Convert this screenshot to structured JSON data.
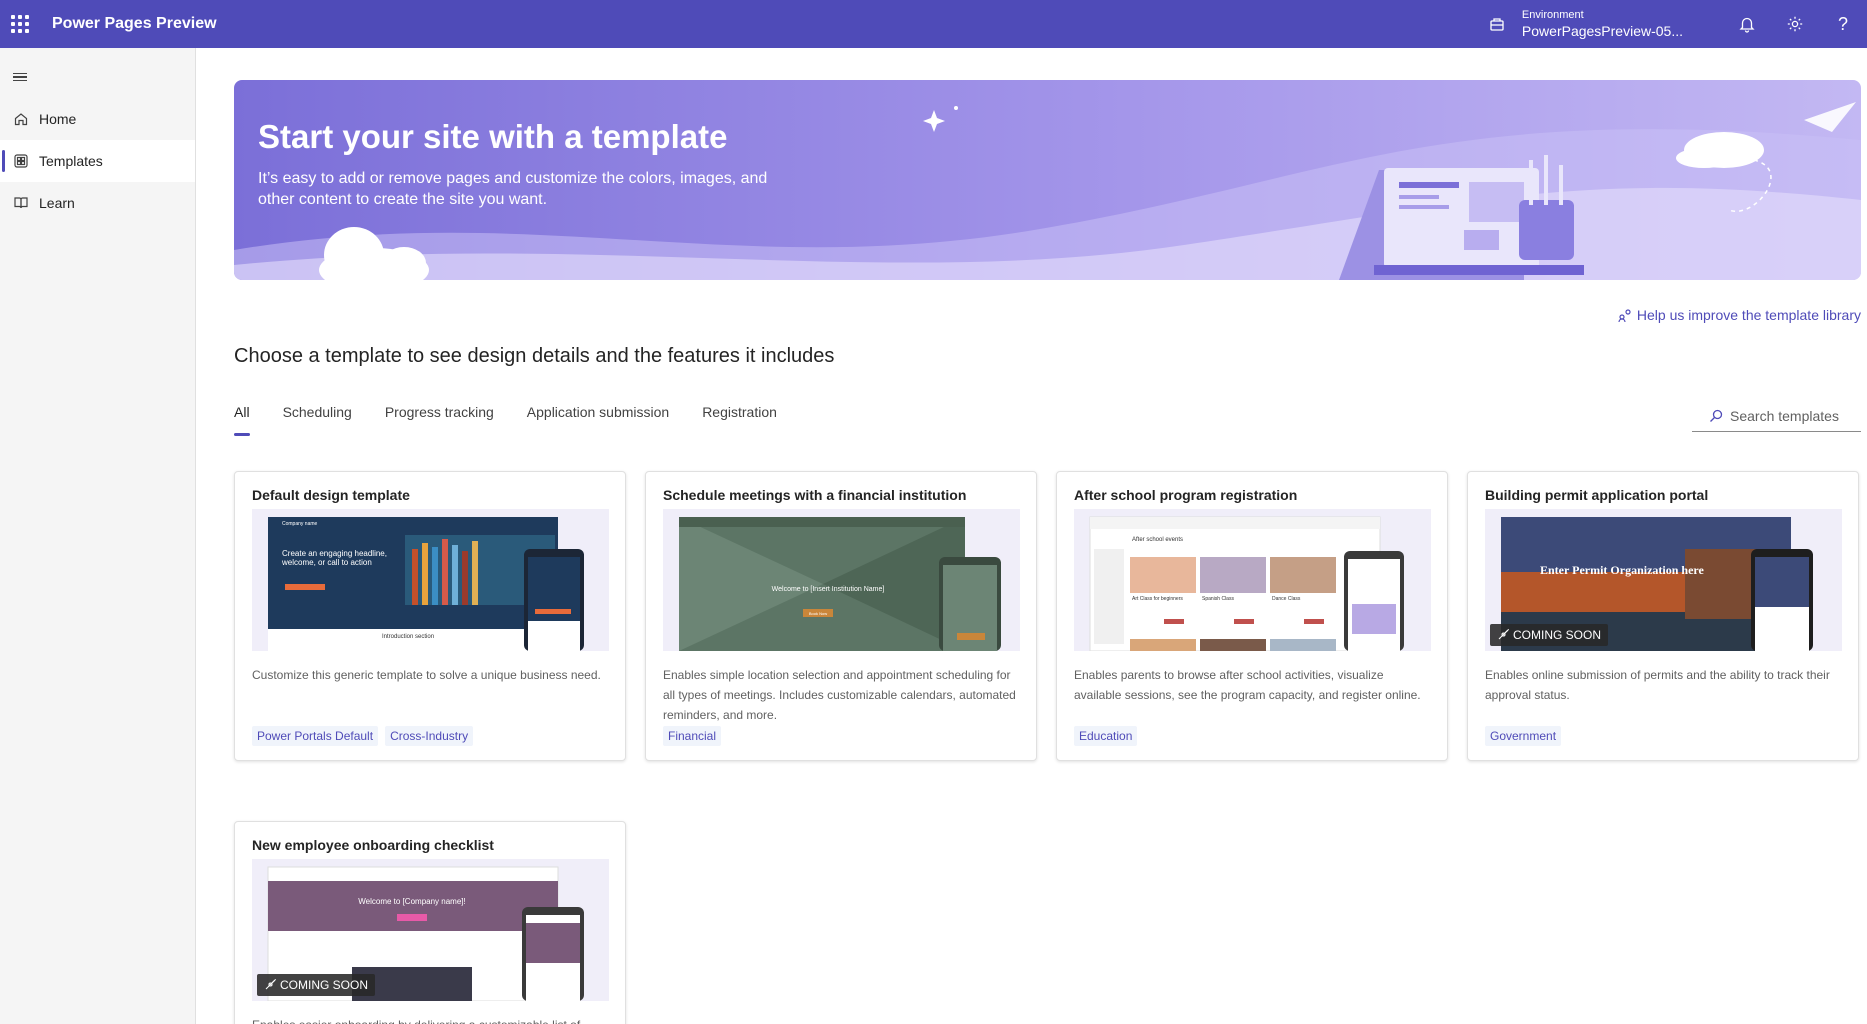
{
  "header": {
    "app_title": "Power Pages Preview",
    "env_label": "Environment",
    "env_value": "PowerPagesPreview-05...",
    "help_label": "?"
  },
  "sidebar": {
    "items": [
      {
        "label": "Home",
        "icon": "home-icon"
      },
      {
        "label": "Templates",
        "icon": "templates-icon",
        "active": true
      },
      {
        "label": "Learn",
        "icon": "book-icon"
      }
    ]
  },
  "banner": {
    "title": "Start your site with a template",
    "subtitle": "It’s easy to add or remove pages and customize the colors, images, and other content to create the site you want."
  },
  "feedback_link": "Help us improve the template library",
  "section_title": "Choose a template to see design details and the features it includes",
  "tabs": [
    "All",
    "Scheduling",
    "Progress tracking",
    "Application submission",
    "Registration"
  ],
  "search": {
    "placeholder": "Search templates"
  },
  "cards": [
    {
      "title": "Default design template",
      "description": "Customize this generic template to solve a unique business need.",
      "tags": [
        "Power Portals Default",
        "Cross-Industry"
      ],
      "preview_text": [
        "Company name",
        "Create an engaging headline, welcome, or call to action",
        "Introduction section"
      ]
    },
    {
      "title": "Schedule meetings with a financial institution",
      "description": "Enables simple location selection and appointment scheduling for all types of meetings. Includes customizable calendars, automated reminders, and more.",
      "tags": [
        "Financial"
      ],
      "preview_text": [
        "Welcome to [Insert Institution Name]",
        "Book Now"
      ]
    },
    {
      "title": "After school program registration",
      "description": "Enables parents to browse after school activities, visualize available sessions, see the program capacity, and register online.",
      "tags": [
        "Education"
      ],
      "preview_text": [
        "After school events",
        "Art Class for beginners",
        "Spanish Class",
        "Dance Class"
      ]
    },
    {
      "title": "Building permit application portal",
      "description": "Enables online submission of permits and the ability to track their approval status.",
      "tags": [
        "Government"
      ],
      "coming_soon": "COMING SOON",
      "preview_text": [
        "Enter Permit Organization here"
      ]
    },
    {
      "title": "New employee onboarding checklist",
      "description": "Enables easier onboarding by delivering a customizable list of",
      "tags": [],
      "coming_soon": "COMING SOON",
      "preview_text": [
        "Welcome to [Company name]!"
      ]
    }
  ],
  "colors": {
    "brand": "#4f4bb8",
    "banner_start": "#7b6fd8",
    "banner_end": "#c3b8f3",
    "sidebar_bg": "#f5f5f5"
  }
}
